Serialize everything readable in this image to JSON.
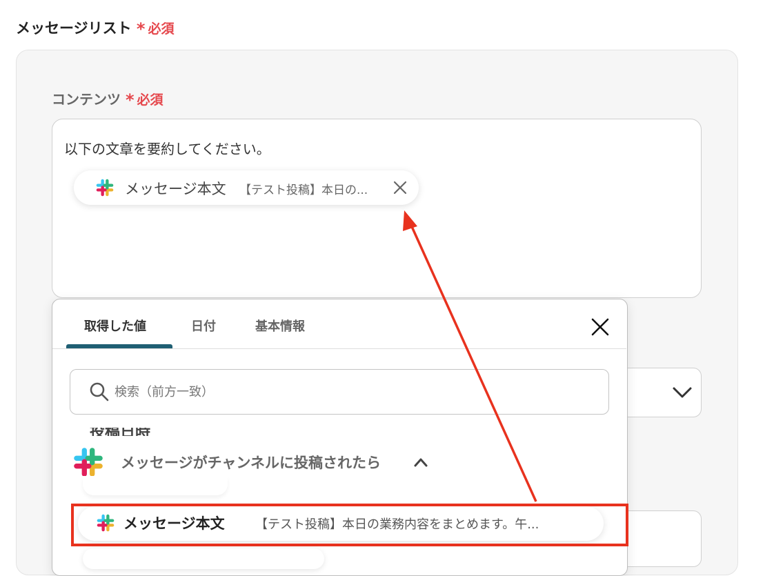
{
  "field": {
    "label": "メッセージリスト",
    "required_label": "必須"
  },
  "content": {
    "label": "コンテンツ",
    "required_label": "必須",
    "text": "以下の文章を要約してください。",
    "chip": {
      "icon": "slack-icon",
      "label": "メッセージ本文",
      "value": "【テスト投稿】本日の..."
    }
  },
  "popup": {
    "tabs": [
      {
        "label": "取得した値",
        "active": true
      },
      {
        "label": "日付",
        "active": false
      },
      {
        "label": "基本情報",
        "active": false
      }
    ],
    "search": {
      "placeholder": "検索（前方一致）",
      "value": ""
    },
    "partial_item_label": "投稿日時",
    "group": {
      "icon": "slack-icon",
      "title": "メッセージがチャンネルに投稿されたら",
      "expanded": true
    },
    "result": {
      "label": "メッセージ本文",
      "value": "【テスト投稿】本日の業務内容をまとめます。午..."
    }
  },
  "colors": {
    "required": "#e5484d",
    "tab_underline": "#1f5f73",
    "highlight": "#e8321e",
    "slack": [
      "#36c5f0",
      "#2eb67d",
      "#ecb22e",
      "#e01e5a"
    ]
  }
}
